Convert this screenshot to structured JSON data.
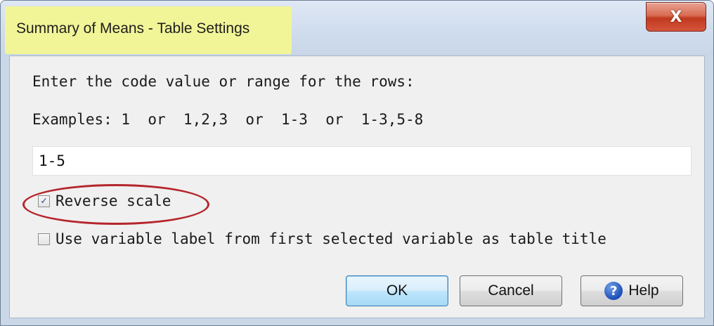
{
  "window": {
    "title": "Summary of Means - Table Settings",
    "close_glyph": "X"
  },
  "form": {
    "prompt": "Enter the code value or range for the rows:",
    "examples": "Examples: 1  or  1,2,3  or  1-3  or  1-3,5-8",
    "range_value": "1-5"
  },
  "options": {
    "reverse_scale": {
      "label": "Reverse scale",
      "checked": true
    },
    "use_variable_label": {
      "label": "Use variable label from first selected variable as table title",
      "checked": false
    }
  },
  "buttons": {
    "ok": "OK",
    "cancel": "Cancel",
    "help": "Help",
    "help_glyph": "?"
  },
  "icons": {
    "close": "close-icon",
    "help": "help-icon",
    "checkbox_checked": "check-icon"
  },
  "colors": {
    "title_highlight": "#f1f597",
    "annotation_circle": "#b5252c",
    "close_button": "#c0391f",
    "default_button": "#bee6fd"
  }
}
